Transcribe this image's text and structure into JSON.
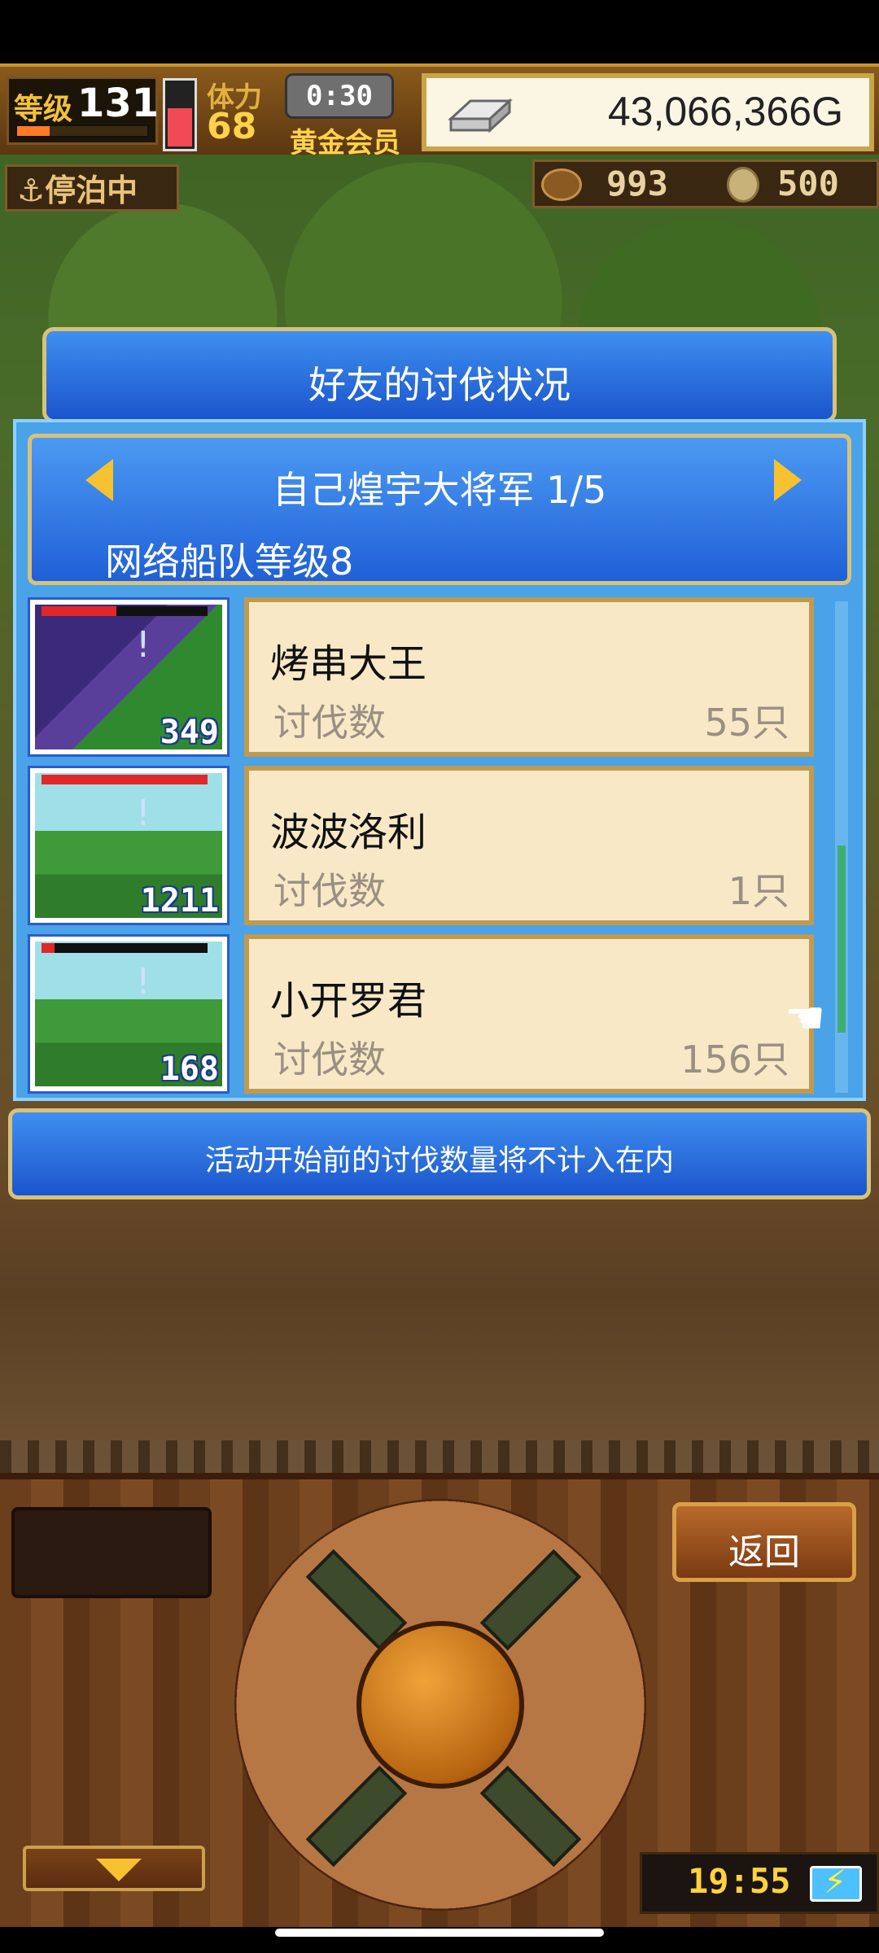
{
  "hud": {
    "level_label": "等级",
    "level_value": "131",
    "exp_fraction": 0.25,
    "stamina_label": "体力",
    "stamina_value": "68",
    "stamina_fraction": 0.6,
    "timer": "0:30",
    "vip_label": "黄金会员",
    "gold_value": "43,066,366G"
  },
  "status": {
    "dock_label": "⚓停泊中",
    "resource1_value": "993",
    "resource2_value": "500"
  },
  "dialog": {
    "title": "好友的讨伐状况",
    "page_title": "自己煌宇大将军 1/5",
    "fleet_level": "网络船队等级8",
    "kills_label": "讨伐数",
    "rows": [
      {
        "thumb_number": "349",
        "hp_fraction": 0.45,
        "name": "烤串大王",
        "kills": "55只"
      },
      {
        "thumb_number": "1211",
        "hp_fraction": 1.0,
        "name": "波波洛利",
        "kills": "1只"
      },
      {
        "thumb_number": "168",
        "hp_fraction": 0.08,
        "name": "小开罗君",
        "kills": "156只"
      }
    ],
    "note": "活动开始前的讨伐数量将不计入在内"
  },
  "controls": {
    "back_label": "返回",
    "clock": "19:55"
  },
  "colors": {
    "dialog_blue": "#2a6fe0",
    "gold_border": "#d8c27a",
    "card_bg": "#f8e8c6",
    "arrow_yellow": "#f6c230"
  },
  "icons": {
    "gold": "silver-bar-icon",
    "dock": "anchor-icon",
    "resource1": "fish-icon",
    "resource2": "coin-icon",
    "battery": "battery-charging-icon"
  }
}
